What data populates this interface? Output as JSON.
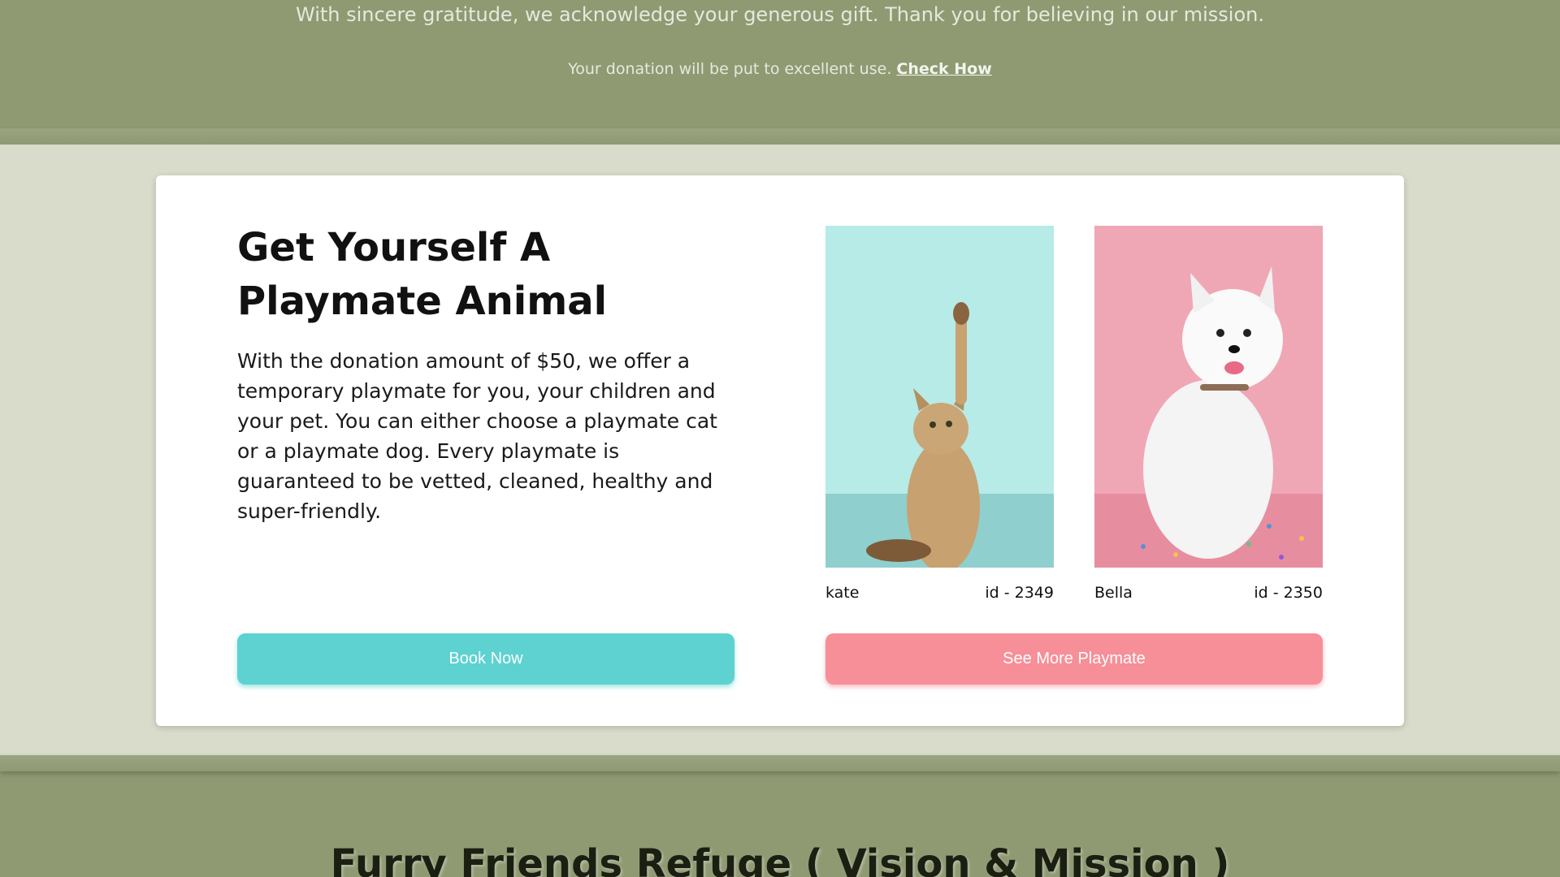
{
  "top": {
    "message": "With sincere gratitude, we acknowledge your generous gift. Thank you for believing in our mission.",
    "sub_text": "Your donation will be put to excellent use.",
    "link_text": "Check How"
  },
  "card": {
    "title": "Get Yourself A Playmate Animal",
    "description": "With the donation amount of $50, we offer a temporary playmate for you, your children and your pet. You can either choose a playmate cat or a playmate dog. Every playmate is guaranteed to be vetted, cleaned, healthy and super-friendly.",
    "pets": [
      {
        "name": "kate",
        "id": "id - 2349",
        "image_icon": "cat-photo"
      },
      {
        "name": "Bella",
        "id": "id - 2350",
        "image_icon": "dog-photo"
      }
    ],
    "book_button": "Book Now",
    "more_button": "See More Playmate"
  },
  "vision": {
    "title": "Furry Friends Refuge ( Vision & Mission )"
  },
  "colors": {
    "olive": "#8f9a73",
    "sage": "#d9dcca",
    "teal": "#5dd2d0",
    "pink": "#f68f98"
  }
}
